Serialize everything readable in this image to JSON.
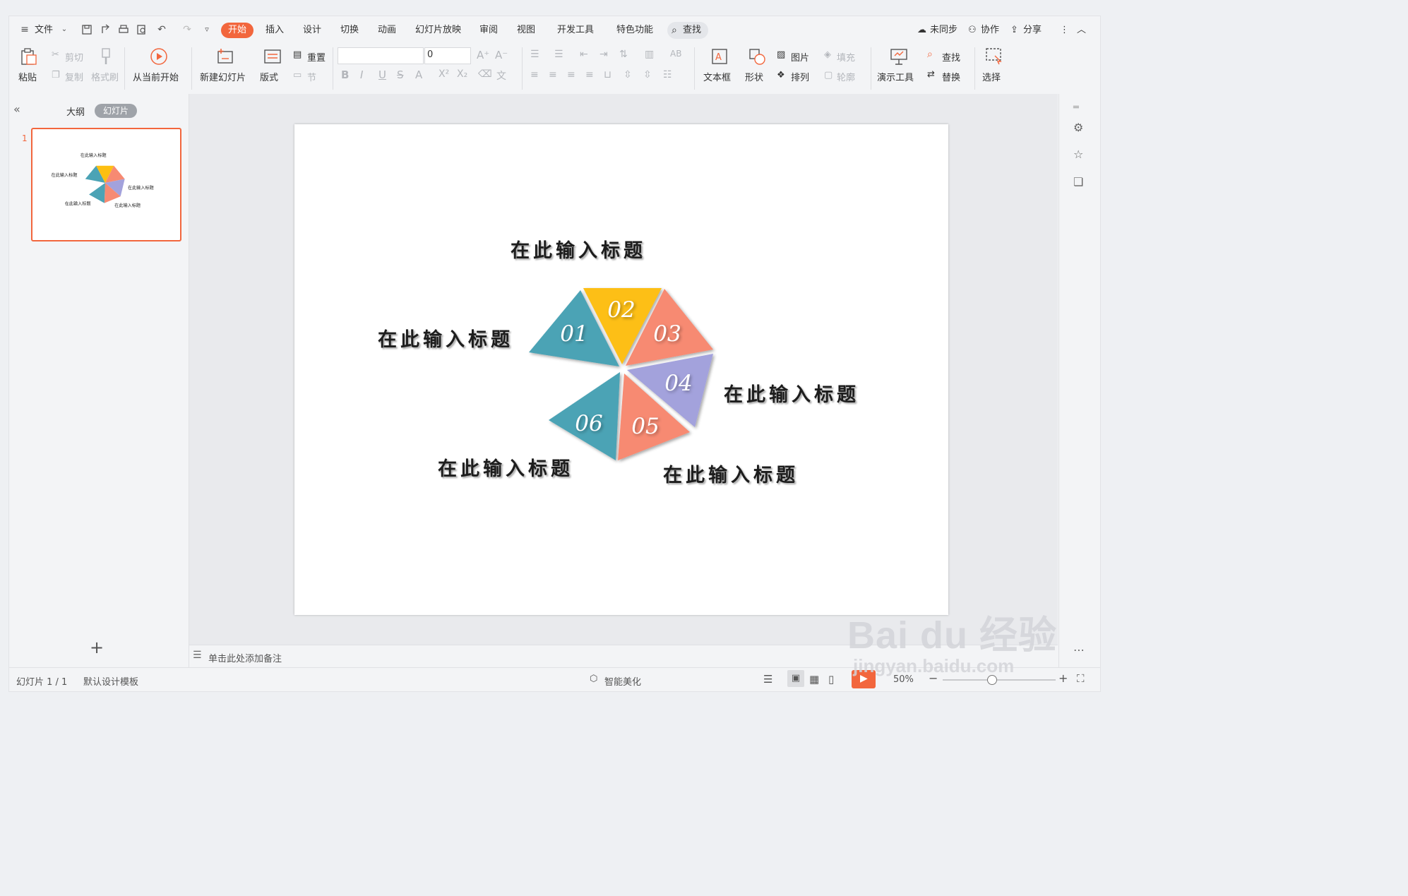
{
  "menu": {
    "file": "文件",
    "tabs": [
      "开始",
      "插入",
      "设计",
      "切换",
      "动画",
      "幻灯片放映",
      "审阅",
      "视图",
      "开发工具",
      "特色功能"
    ],
    "active_tab": "开始",
    "search": "查找",
    "sync": "未同步",
    "collab": "协作",
    "share": "分享"
  },
  "ribbon": {
    "paste": "粘贴",
    "cut": "剪切",
    "copy": "复制",
    "format_painter": "格式刷",
    "from_current": "从当前开始",
    "new_slide": "新建幻灯片",
    "layout": "版式",
    "reset": "重置",
    "section": "节",
    "font_size": "0",
    "textbox": "文本框",
    "shape": "形状",
    "picture": "图片",
    "fill": "填充",
    "arrange": "排列",
    "outline": "轮廓",
    "present_tools": "演示工具",
    "find": "查找",
    "replace": "替换",
    "select": "选择"
  },
  "panel": {
    "outline_tab": "大纲",
    "slides_tab": "幻灯片",
    "slide_number": "1"
  },
  "slide": {
    "titles": [
      "在此输入标题",
      "在此输入标题",
      "在此输入标题",
      "在此输入标题",
      "在此输入标题"
    ],
    "segments": [
      {
        "label": "01",
        "color": "#4ba3b5"
      },
      {
        "label": "02",
        "color": "#fdbf12"
      },
      {
        "label": "03",
        "color": "#f78a72"
      },
      {
        "label": "04",
        "color": "#a3a2dc"
      },
      {
        "label": "05",
        "color": "#f78a72"
      },
      {
        "label": "06",
        "color": "#4ba3b5"
      }
    ]
  },
  "notes_placeholder": "单击此处添加备注",
  "status": {
    "slide_info": "幻灯片 1 / 1",
    "template": "默认设计模板",
    "beautify": "智能美化",
    "zoom": "50%"
  },
  "watermark": {
    "brand": "Bai du 经验",
    "url": "jingyan.baidu.com"
  },
  "colors": {
    "accent": "#f2663d"
  }
}
